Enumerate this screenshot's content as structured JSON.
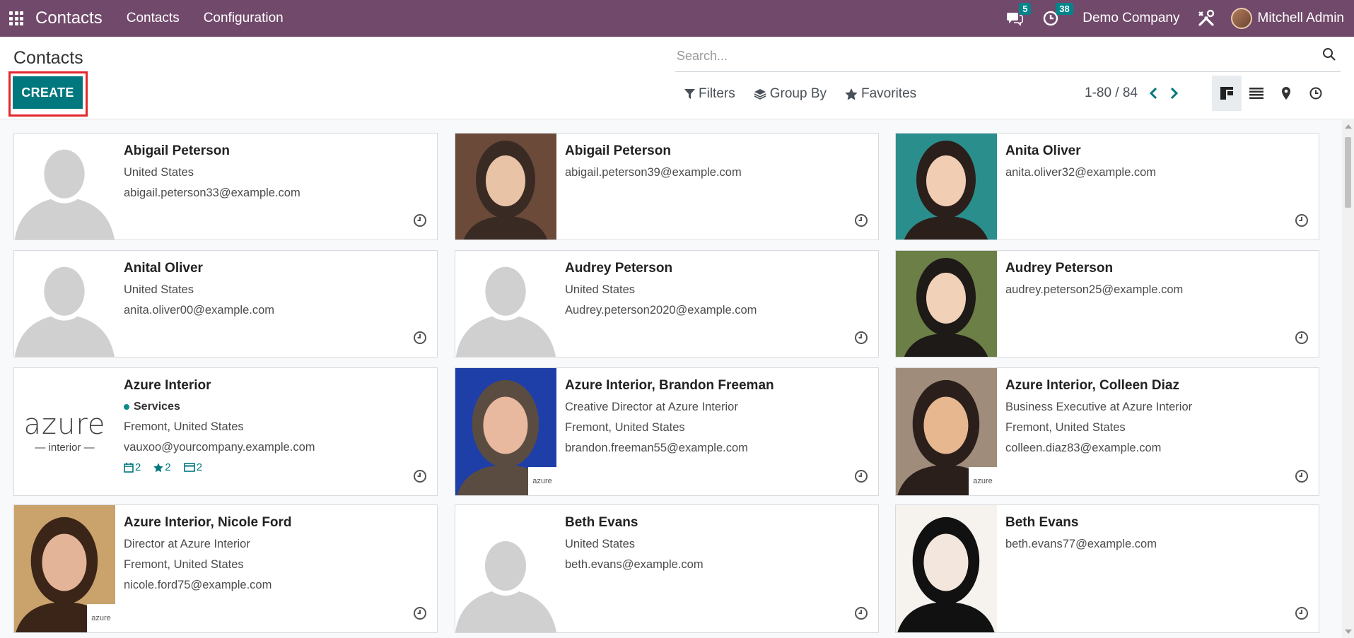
{
  "navbar": {
    "brand": "Contacts",
    "menu": [
      "Contacts",
      "Configuration"
    ],
    "messages_badge": "5",
    "activities_badge": "38",
    "company": "Demo Company",
    "username": "Mitchell Admin",
    "icons": [
      "apps-grid-icon",
      "chat-icon",
      "clock-icon",
      "tools-icon",
      "avatar"
    ]
  },
  "control_panel": {
    "breadcrumb": "Contacts",
    "create_label": "CREATE",
    "search_placeholder": "Search...",
    "filters_label": "Filters",
    "group_by_label": "Group By",
    "favorites_label": "Favorites",
    "pager": "1-80 / 84",
    "views": [
      "kanban-view-icon",
      "list-view-icon",
      "map-view-icon",
      "activity-view-icon"
    ]
  },
  "colors": {
    "navbar": "#71496b",
    "primary": "#01787e",
    "highlight": "#e3262a",
    "badge": "#01858b"
  },
  "cards": [
    {
      "name": "Abigail Peterson",
      "lines": [
        "United States",
        "abigail.peterson33@example.com"
      ],
      "image": "placeholder"
    },
    {
      "name": "Abigail Peterson",
      "lines": [
        "abigail.peterson39@example.com"
      ],
      "image": "photo"
    },
    {
      "name": "Anita Oliver",
      "lines": [
        "anita.oliver32@example.com"
      ],
      "image": "photo"
    },
    {
      "name": "Anital Oliver",
      "lines": [
        "United States",
        "anita.oliver00@example.com"
      ],
      "image": "placeholder"
    },
    {
      "name": "Audrey Peterson",
      "lines": [
        "United States",
        "Audrey.peterson2020@example.com"
      ],
      "image": "placeholder"
    },
    {
      "name": "Audrey Peterson",
      "lines": [
        "audrey.peterson25@example.com"
      ],
      "image": "photo"
    },
    {
      "name": "Azure Interior",
      "tag": "Services",
      "lines": [
        "Fremont, United States",
        "vauxoo@yourcompany.example.com"
      ],
      "stats": [
        "2",
        "2",
        "2"
      ],
      "image": "azure-logo",
      "logo_text": [
        "azure",
        "interior"
      ]
    },
    {
      "name": "Azure Interior, Brandon Freeman",
      "lines": [
        "Creative Director at Azure Interior",
        "Fremont, United States",
        "brandon.freeman55@example.com"
      ],
      "image": "photo",
      "company_logo": "azure"
    },
    {
      "name": "Azure Interior, Colleen Diaz",
      "lines": [
        "Business Executive at Azure Interior",
        "Fremont, United States",
        "colleen.diaz83@example.com"
      ],
      "image": "photo",
      "company_logo": "azure"
    },
    {
      "name": "Azure Interior, Nicole Ford",
      "lines": [
        "Director at Azure Interior",
        "Fremont, United States",
        "nicole.ford75@example.com"
      ],
      "image": "photo",
      "company_logo": "azure"
    },
    {
      "name": "Beth Evans",
      "lines": [
        "United States",
        "beth.evans@example.com"
      ],
      "image": "placeholder"
    },
    {
      "name": "Beth Evans",
      "lines": [
        "beth.evans77@example.com"
      ],
      "image": "photo"
    }
  ]
}
